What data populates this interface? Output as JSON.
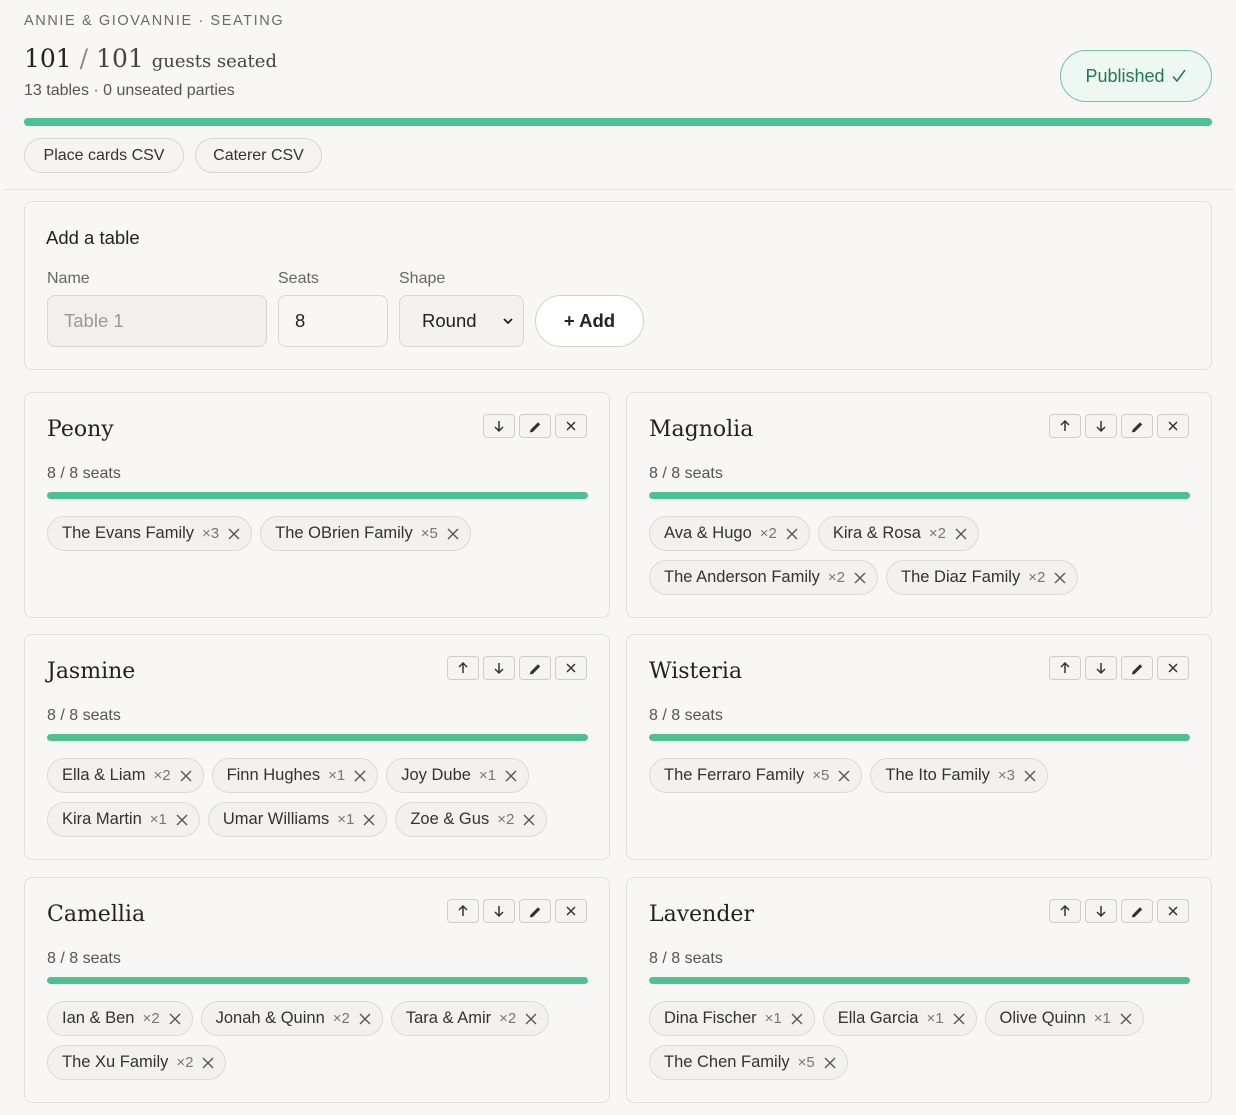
{
  "header": {
    "eyebrow": "ANNIE & GIOVANNIE · SEATING",
    "seated": "101",
    "total": "101",
    "seated_label": "guests seated",
    "subtitle": "13 tables · 0 unseated parties",
    "published_label": "Published",
    "published_icon": "check-icon",
    "progress": 1.0,
    "accent_color": "#4fc08f"
  },
  "exports": {
    "place_cards": "Place cards CSV",
    "caterer": "Caterer CSV"
  },
  "add_table": {
    "title": "Add a table",
    "name_label": "Name",
    "name_placeholder": "Table 1",
    "seats_label": "Seats",
    "seats_value": "8",
    "shape_label": "Shape",
    "shape_value": "Round",
    "add_label": "+ Add"
  },
  "tables": [
    {
      "name": "Peony",
      "seats": "8 / 8 seats",
      "fill": 1.0,
      "actions": [
        "arrow-down-icon",
        "pencil-icon",
        "close-icon"
      ],
      "parties": [
        {
          "name": "The Evans Family",
          "count": "×3"
        },
        {
          "name": "The OBrien Family",
          "count": "×5"
        }
      ]
    },
    {
      "name": "Magnolia",
      "seats": "8 / 8 seats",
      "fill": 1.0,
      "actions": [
        "arrow-up-icon",
        "arrow-down-icon",
        "pencil-icon",
        "close-icon"
      ],
      "parties": [
        {
          "name": "Ava & Hugo",
          "count": "×2"
        },
        {
          "name": "Kira & Rosa",
          "count": "×2"
        },
        {
          "name": "The Anderson Family",
          "count": "×2"
        },
        {
          "name": "The Diaz Family",
          "count": "×2"
        }
      ]
    },
    {
      "name": "Jasmine",
      "seats": "8 / 8 seats",
      "fill": 1.0,
      "actions": [
        "arrow-up-icon",
        "arrow-down-icon",
        "pencil-icon",
        "close-icon"
      ],
      "parties": [
        {
          "name": "Ella & Liam",
          "count": "×2"
        },
        {
          "name": "Finn Hughes",
          "count": "×1"
        },
        {
          "name": "Joy Dube",
          "count": "×1"
        },
        {
          "name": "Kira Martin",
          "count": "×1"
        },
        {
          "name": "Umar Williams",
          "count": "×1"
        },
        {
          "name": "Zoe & Gus",
          "count": "×2"
        }
      ]
    },
    {
      "name": "Wisteria",
      "seats": "8 / 8 seats",
      "fill": 1.0,
      "actions": [
        "arrow-up-icon",
        "arrow-down-icon",
        "pencil-icon",
        "close-icon"
      ],
      "parties": [
        {
          "name": "The Ferraro Family",
          "count": "×5"
        },
        {
          "name": "The Ito Family",
          "count": "×3"
        }
      ]
    },
    {
      "name": "Camellia",
      "seats": "8 / 8 seats",
      "fill": 1.0,
      "actions": [
        "arrow-up-icon",
        "arrow-down-icon",
        "pencil-icon",
        "close-icon"
      ],
      "parties": [
        {
          "name": "Ian & Ben",
          "count": "×2"
        },
        {
          "name": "Jonah & Quinn",
          "count": "×2"
        },
        {
          "name": "Tara & Amir",
          "count": "×2"
        },
        {
          "name": "The Xu Family",
          "count": "×2"
        }
      ]
    },
    {
      "name": "Lavender",
      "seats": "8 / 8 seats",
      "fill": 1.0,
      "actions": [
        "arrow-up-icon",
        "arrow-down-icon",
        "pencil-icon",
        "close-icon"
      ],
      "parties": [
        {
          "name": "Dina Fischer",
          "count": "×1"
        },
        {
          "name": "Ella Garcia",
          "count": "×1"
        },
        {
          "name": "Olive Quinn",
          "count": "×1"
        },
        {
          "name": "The Chen Family",
          "count": "×5"
        }
      ]
    }
  ]
}
